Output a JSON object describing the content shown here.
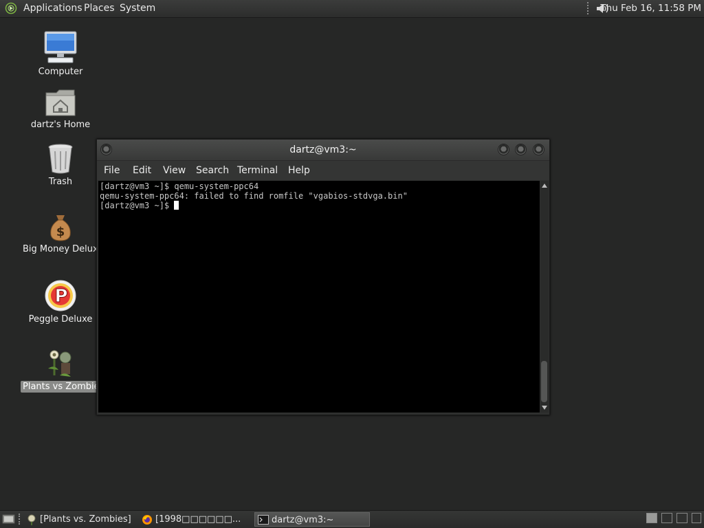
{
  "top_panel": {
    "menus": [
      "Applications",
      "Places",
      "System"
    ],
    "clock": "Thu Feb 16, 11:58 PM"
  },
  "desktop": {
    "icons": [
      {
        "label": "Computer",
        "icon": "computer-icon"
      },
      {
        "label": "dartz's Home",
        "icon": "home-folder-icon"
      },
      {
        "label": "Trash",
        "icon": "trash-icon"
      },
      {
        "label": "Big Money Deluxe",
        "icon": "money-bag-icon"
      },
      {
        "label": "Peggle Deluxe",
        "icon": "peggle-icon"
      },
      {
        "label": "Plants vs Zombies",
        "icon": "plants-vs-zombies-icon"
      }
    ]
  },
  "window": {
    "title": "dartz@vm3:~",
    "menus": [
      "File",
      "Edit",
      "View",
      "Search",
      "Terminal",
      "Help"
    ],
    "terminal_lines": [
      "[dartz@vm3 ~]$ qemu-system-ppc64",
      "qemu-system-ppc64: failed to find romfile \"vgabios-stdvga.bin\"",
      "[dartz@vm3 ~]$ "
    ]
  },
  "bottom_panel": {
    "tasks": [
      {
        "label": "[Plants vs. Zombies]",
        "icon": "plants-vs-zombies-icon",
        "active": false
      },
      {
        "label": "[1998□□□□□□...",
        "icon": "firefox-icon",
        "active": false
      },
      {
        "label": "dartz@vm3:~",
        "icon": "terminal-icon",
        "active": true
      }
    ]
  },
  "colors": {
    "desktop_bg": "#262726",
    "terminal_bg": "#000000",
    "terminal_fg": "#c8c8c8"
  }
}
